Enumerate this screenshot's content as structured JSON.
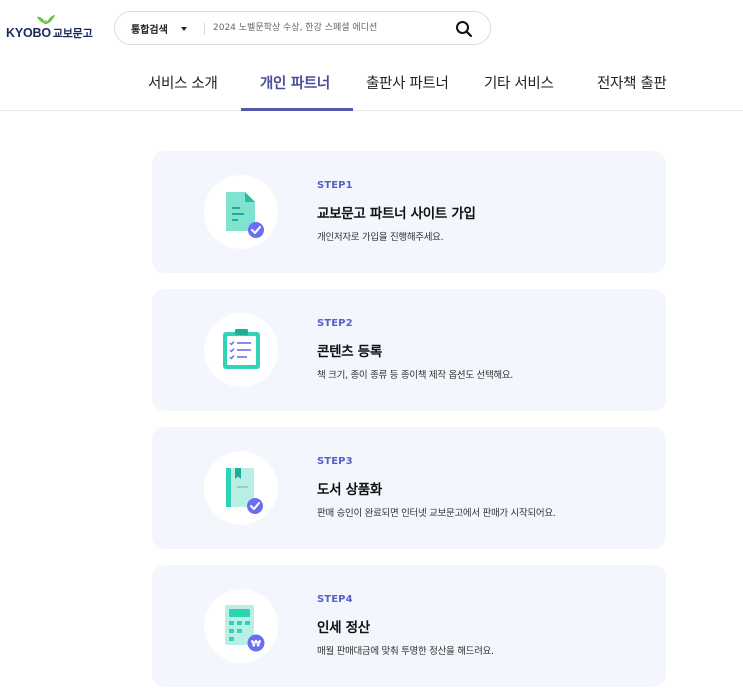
{
  "header": {
    "logo_text_en": "KYOBO",
    "logo_text_ko": "교보문고",
    "search": {
      "category": "통합검색",
      "placeholder": "2024 노벨문학상 수상, 한강 스페셜 에디션"
    }
  },
  "nav": {
    "items": [
      {
        "label": "서비스 소개"
      },
      {
        "label": "개인 파트너"
      },
      {
        "label": "출판사 파트너"
      },
      {
        "label": "기타 서비스"
      },
      {
        "label": "전자책 출판"
      }
    ],
    "active_index": 1
  },
  "steps": [
    {
      "step": "STEP1",
      "title": "교보문고 파트너 사이트 가입",
      "desc": "개인저자로 가입을 진행해주세요.",
      "icon": "document-check-icon"
    },
    {
      "step": "STEP2",
      "title": "콘텐츠 등록",
      "desc": "책 크기, 종이 종류 등 종이책 제작 옵션도 선택해요.",
      "icon": "clipboard-list-icon"
    },
    {
      "step": "STEP3",
      "title": "도서 상품화",
      "desc": "판매 승인이 완료되면 인터넷 교보문고에서 판매가 시작되어요.",
      "icon": "book-check-icon"
    },
    {
      "step": "STEP4",
      "title": "인세 정산",
      "desc": "매월 판매대금에 맞춰 투명한 정산을 해드려요.",
      "icon": "calculator-won-icon"
    }
  ],
  "colors": {
    "accent": "#555aa8",
    "step_label": "#5a5fc8",
    "card_bg": "#f4f6fe",
    "icon_teal": "#2fd3b6",
    "icon_purple": "#6b6ef0"
  }
}
